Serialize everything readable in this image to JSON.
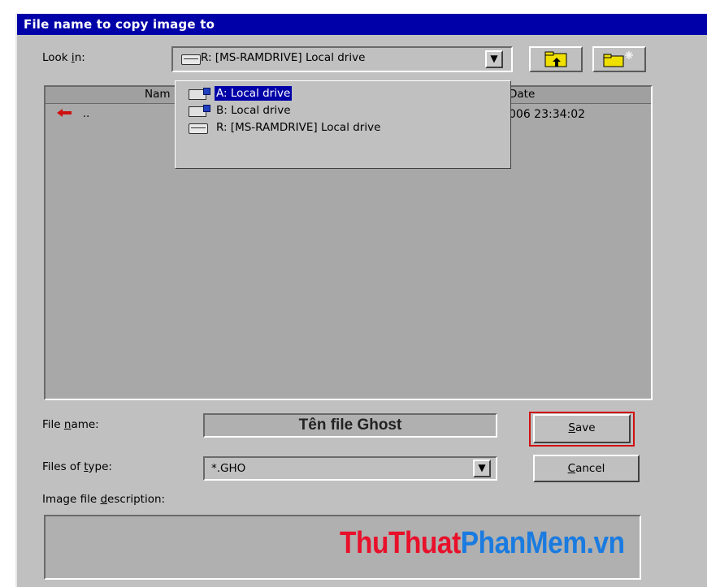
{
  "window": {
    "title": "File name to copy image to"
  },
  "look_in": {
    "label_pre": "Look ",
    "label_u": "i",
    "label_post": "n:",
    "value": "R: [MS-RAMDRIVE] Local drive"
  },
  "toolbar": {
    "up_folder_icon": "up-one-level-icon",
    "new_folder_icon": "new-folder-icon"
  },
  "file_list": {
    "columns": [
      {
        "label": "Nam"
      },
      {
        "label": "Date"
      }
    ],
    "rows": [
      {
        "name": "..",
        "date": "006 23:34:02"
      }
    ]
  },
  "drive_dropdown": {
    "items": [
      {
        "label": "A: Local drive",
        "icon": "floppy-drive-icon",
        "selected": true
      },
      {
        "label": "B: Local drive",
        "icon": "floppy-drive-icon",
        "selected": false
      },
      {
        "label": "R: [MS-RAMDRIVE] Local drive",
        "icon": "hard-drive-icon",
        "selected": false
      }
    ]
  },
  "file_name": {
    "label_pre": "File ",
    "label_u": "n",
    "label_post": "ame:",
    "value": "Tên file Ghost"
  },
  "file_type": {
    "label_pre": "Files of ",
    "label_u": "t",
    "label_post": "ype:",
    "value": "*.GHO"
  },
  "description": {
    "label_pre": "Image file ",
    "label_u": "d",
    "label_post": "escription:",
    "value": ""
  },
  "buttons": {
    "save": {
      "u": "S",
      "rest": "ave"
    },
    "cancel": {
      "u": "C",
      "rest": "ancel"
    }
  },
  "watermark": {
    "part1": "ThuThuat",
    "part2": "PhanMem.vn"
  },
  "colors": {
    "titlebar": "#0000a8",
    "highlight": "#d01010",
    "watermark_red": "#e8102a",
    "watermark_blue": "#1a7be0"
  }
}
